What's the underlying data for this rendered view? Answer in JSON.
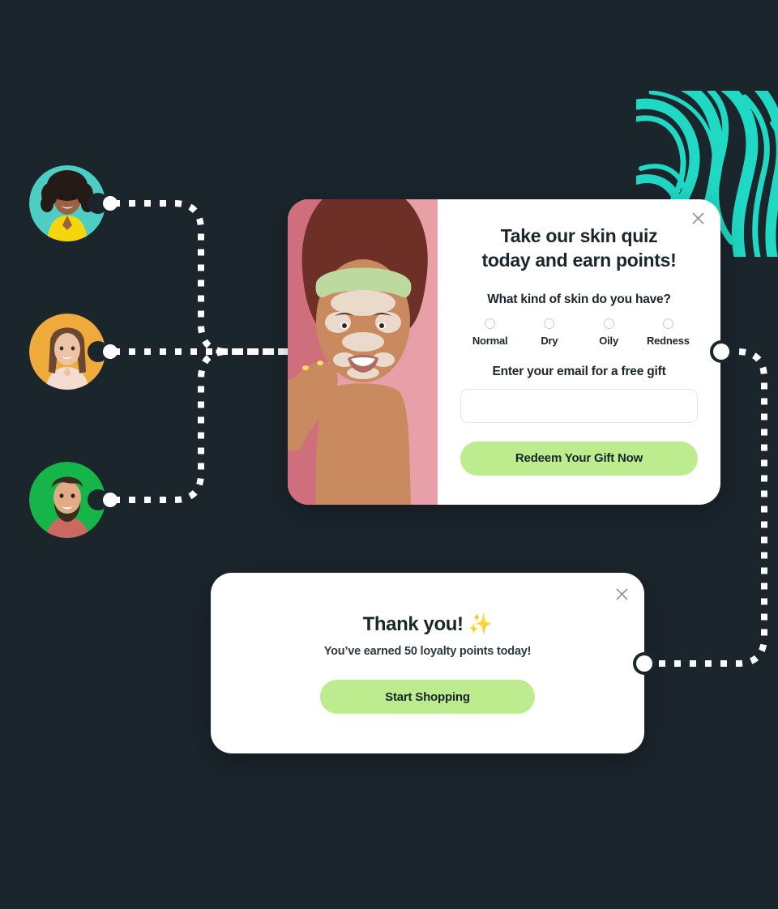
{
  "page": {
    "background_color": "#1b252c",
    "accent_green": "#bdec8f",
    "accent_teal": "#1fd9c5",
    "text_dark": "#1b252c"
  },
  "avatars": [
    {
      "name": "avatar-customer-1",
      "bg_color": "#4ecdc4",
      "hair_color": "#241a16",
      "skin_color": "#9c6240",
      "shirt_color": "#f5d60b"
    },
    {
      "name": "avatar-customer-2",
      "bg_color": "#eeab3b",
      "hair_color": "#6b4630",
      "skin_color": "#edc3a6",
      "shirt_color": "#f3ddd0"
    },
    {
      "name": "avatar-customer-3",
      "bg_color": "#15b54a",
      "hair_color": "#3b2a1e",
      "skin_color": "#e2ab85",
      "shirt_color": "#c9695f"
    }
  ],
  "quiz_modal": {
    "title_line1": "Take our skin quiz",
    "title_line2": "today and earn points!",
    "question": "What kind of skin do you have?",
    "options": [
      {
        "label": "Normal",
        "selected": false
      },
      {
        "label": "Dry",
        "selected": false
      },
      {
        "label": "Oily",
        "selected": false
      },
      {
        "label": "Redness",
        "selected": false
      }
    ],
    "email_label": "Enter your email for a free gift",
    "email_value": "",
    "email_placeholder": "",
    "cta_label": "Redeem Your Gift Now",
    "close_icon": "close-icon",
    "photo": {
      "name": "skincare-model-photo",
      "bg_color": "#e8a0a8",
      "headband_color": "#bcd9a0",
      "hair_color": "#6e2f27",
      "skin_color": "#c98a5f"
    }
  },
  "thank_you_modal": {
    "title": "Thank you! ✨",
    "subtitle": "You’ve earned 50 loyalty points today!",
    "cta_label": "Start Shopping",
    "close_icon": "close-icon"
  }
}
